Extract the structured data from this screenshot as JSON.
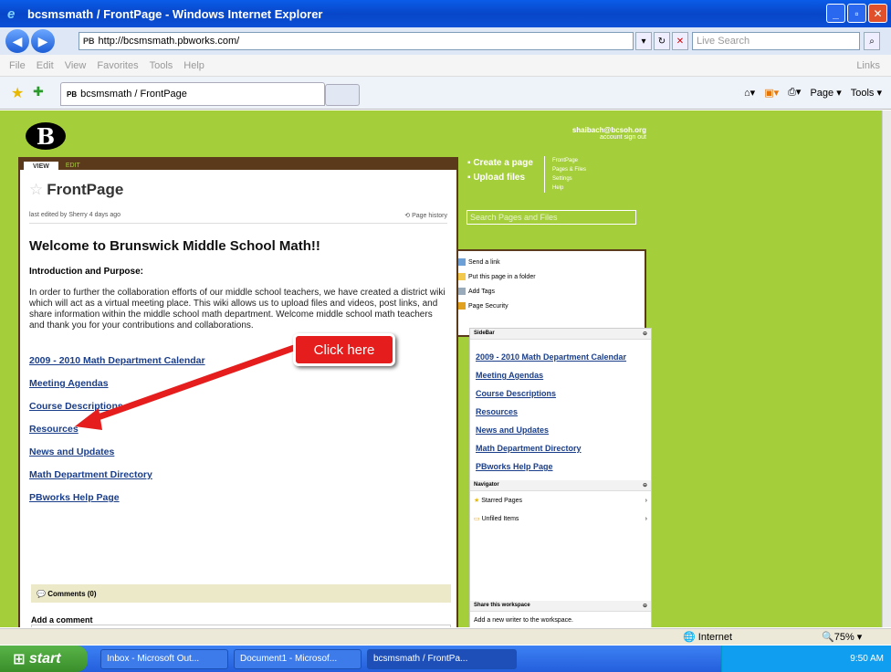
{
  "window": {
    "title": "bcsmsmath / FrontPage - Windows Internet Explorer"
  },
  "address": {
    "value": "http://bcsmsmath.pbworks.com/",
    "search_placeholder": "Live Search"
  },
  "menu": [
    "File",
    "Edit",
    "View",
    "Favorites",
    "Tools",
    "Help"
  ],
  "menu_links": "Links",
  "tab": {
    "label": "bcsmsmath / FrontPage",
    "page_btn": "Page",
    "tools_btn": "Tools"
  },
  "account": {
    "email": "shaibach@bcsoh.org",
    "links": "account  sign out"
  },
  "page": {
    "view_tab": "VIEW",
    "edit_tab": "EDIT",
    "title": "FrontPage",
    "edited": "last edited by Sherry 4 days ago",
    "history": "Page history",
    "heading": "Welcome to Brunswick Middle School Math!!",
    "intro_heading": "Introduction and Purpose:",
    "paragraph": "In order to further the collaboration efforts of our middle school teachers, we have created a district wiki which will act as a virtual meeting place. This wiki allows us to upload files and videos, post links, and share information within the middle school math department.  Welcome middle school math teachers and thank you for your contributions and collaborations.",
    "links": [
      "2009 - 2010 Math Department Calendar",
      "Meeting Agendas",
      "Course Descriptions",
      "Resources",
      "News and Updates",
      "Math Department Directory",
      "PBworks Help Page"
    ],
    "comments": "Comments (0)",
    "add_comment": "Add a comment"
  },
  "callout": "Click here",
  "actions": {
    "create": "Create a page",
    "upload": "Upload files",
    "nav": [
      "FrontPage",
      "Pages & Files",
      "Settings",
      "Help"
    ],
    "search": "Search Pages and Files"
  },
  "page_actions": [
    "Send a link",
    "Put this page in a folder",
    "Add Tags",
    "Page Security"
  ],
  "sidebar": {
    "title": "SideBar",
    "links": [
      "2009 - 2010 Math Department Calendar",
      "Meeting Agendas",
      "Course Descriptions",
      "Resources",
      "News and Updates",
      "Math Department Directory",
      "PBworks Help Page"
    ],
    "navigator": "Navigator",
    "starred": "Starred Pages",
    "unfiled": "Unfiled Items",
    "share": "Share this workspace",
    "share_text": "Add a new writer to the workspace."
  },
  "status": {
    "zone": "Internet",
    "zoom": "75%"
  },
  "taskbar": {
    "start": "start",
    "tasks": [
      "Inbox - Microsoft Out...",
      "Document1 - Microsof...",
      "bcsmsmath / FrontPa..."
    ],
    "time": "9:50 AM"
  }
}
